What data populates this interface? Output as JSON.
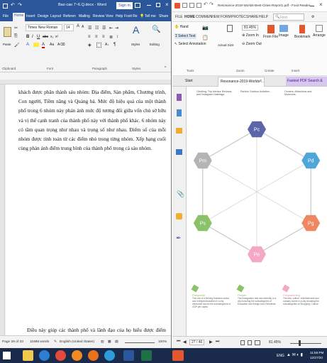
{
  "word": {
    "title": "Bao cao 7~6.Q.docx - Word",
    "sign_in": "Sign in",
    "menu": [
      "File",
      "Home",
      "Insert",
      "Design",
      "Layout",
      "Referen",
      "Mailing",
      "Review",
      "View",
      "Help",
      "Foxit Re",
      "Tell me",
      "Share"
    ],
    "ribbon": {
      "paste": "Paste",
      "font_name": "Times New Roman",
      "font_size": "14",
      "styles": "Styles",
      "editing": "Editing",
      "groups": [
        "Clipboard",
        "Font",
        "Paragraph",
        "Styles"
      ]
    },
    "body_text": "khách được phân thành sáu nhóm: Địa điểm, Sản phẩm, Chương trình, Con người, Tiềm năng và Quảng bá. Mức độ hiệu quả của một thành phố trong 6 nhóm này phản ánh mức độ tương đối giữa vốn chủ sở hữu và vị thế cạnh tranh của thành phố này với thành phố khác. 6 nhóm này có tầm quan trọng như nhau và trọng số như nhau. Điểm số của mỗi nhóm được tính toán từ các điểm nhỏ trong từng nhóm. Xếp hạng cuối cùng phản ánh điểm trung bình của thành phố trong cả sáu nhóm.",
    "body_text_2": "Điều này giúp các thành phố và lãnh đạo của họ hiểu được điểm mạnh và điểm yếu của họ thông qua lăng kính của những người đến thăm và sinh sống ở mỗi",
    "status": {
      "page": "Page 28 of 33",
      "words": "11688 words",
      "language": "English (United States)",
      "zoom": "100%"
    }
  },
  "foxit": {
    "title": "Resonance-2019-Worlds-Best-Cities-Report1.pdf - Foxit Reader",
    "search_placeholder": "Find",
    "menu": [
      "FILE",
      "HOME",
      "COMMEN",
      "VIEW",
      "FORM",
      "PROTEC",
      "SHARE",
      "HELP"
    ],
    "ribbon_groups": [
      "Tools",
      "Zoom",
      "Create",
      "Insert"
    ],
    "ribbon_items": [
      "Hand",
      "Select Text",
      "Select Annotation",
      "Snapshot",
      "Clipboard",
      "Actual Size",
      "Fit Page",
      "Zoom In",
      "Zoom Out",
      "From File",
      "Image",
      "Bookmark",
      "Arrange"
    ],
    "zoom_value": "81.45%",
    "tabs": {
      "start": "Start",
      "doc": "Resonance-2019-Worlds-...",
      "ad": "Fastest PDF Search &"
    },
    "page_top_text": [
      "Climbing, Trip Advisor Reviews, and Instagram Hashtags.",
      "Particle Outdoor Activities.",
      "Centers, Attractions and Museums."
    ],
    "hexagon": {
      "nodes": [
        {
          "label": "Pc",
          "color": "#5a66a8"
        },
        {
          "label": "Pd",
          "color": "#4fa7d9"
        },
        {
          "label": "Pg",
          "color": "#ef8760"
        },
        {
          "label": "Pe",
          "color": "#f5a8c4"
        },
        {
          "label": "Ps",
          "color": "#8cc16c"
        },
        {
          "label": "Pm",
          "color": "#b4b4b4"
        }
      ]
    },
    "legend": [
      {
        "title": "Prosperity",
        "color": "#8cc16c",
        "text": "The role of a thriving business sector and entrepreneurialism in a city measured across the subcategories of GDP per capita"
      },
      {
        "title": "People",
        "color": "#8cc16c",
        "text": "The immigration rate and diversity of a city including the subcategories of Education and foreign-born Residents"
      },
      {
        "title": "Programming",
        "color": "#f5a8c4",
        "text": "The arts, culture, entertainment and culinary scene in a city including the subcategories of Shopping, Culture"
      }
    ],
    "nav": {
      "page": "27 / 46",
      "zoom": "81.45%"
    }
  },
  "taskbar": {
    "lang": "ENG",
    "time": "11:58 PM",
    "date": "12/27/20"
  }
}
